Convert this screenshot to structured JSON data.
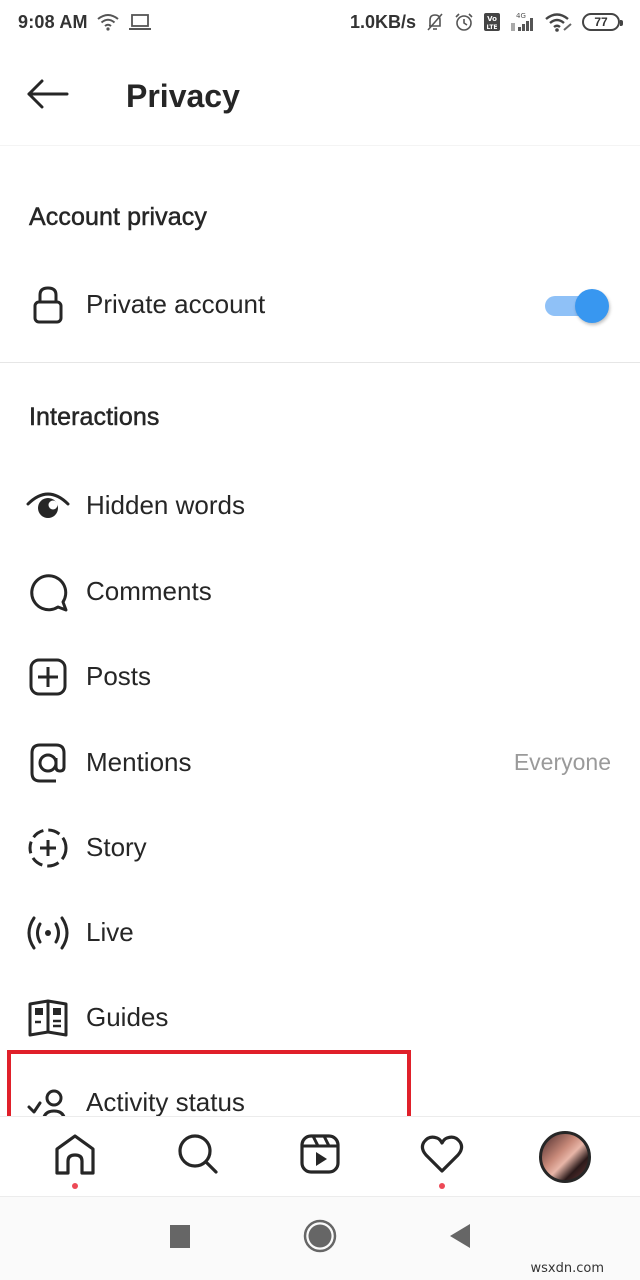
{
  "status_bar": {
    "time": "9:08 AM",
    "network_speed": "1.0KB/s",
    "battery_level": "77",
    "icons_left": [
      "wifi-icon",
      "laptop-icon"
    ],
    "icons_right": [
      "bell-muted-icon",
      "alarm-icon",
      "volte-icon",
      "signal-4g-icon",
      "wifi-icon",
      "battery-icon"
    ],
    "volte_label": "Vo\nLTE",
    "network_type": "4G"
  },
  "header": {
    "back_icon": "arrow-left-icon",
    "title": "Privacy"
  },
  "sections": [
    {
      "title": "Account privacy",
      "items": [
        {
          "label": "Private account",
          "icon": "lock-icon",
          "toggle": true,
          "toggle_on": true
        }
      ]
    },
    {
      "title": "Interactions",
      "items": [
        {
          "label": "Hidden words",
          "icon": "eye-icon"
        },
        {
          "label": "Comments",
          "icon": "comment-icon"
        },
        {
          "label": "Posts",
          "icon": "plus-square-icon"
        },
        {
          "label": "Mentions",
          "icon": "at-sign-icon",
          "value": "Everyone"
        },
        {
          "label": "Story",
          "icon": "story-add-icon"
        },
        {
          "label": "Live",
          "icon": "live-broadcast-icon"
        },
        {
          "label": "Guides",
          "icon": "guide-book-icon"
        },
        {
          "label": "Activity status",
          "icon": "activity-status-icon",
          "highlighted": true
        }
      ]
    }
  ],
  "colors": {
    "toggle_on": "#3897f0",
    "toggle_track": "#8fc1f7",
    "highlight_border": "#e0202a",
    "notification_dot": "#ed4956",
    "secondary_text": "#9a9a9a"
  },
  "bottom_nav": {
    "items": [
      {
        "name": "home",
        "icon": "home-icon",
        "dot": true
      },
      {
        "name": "search",
        "icon": "search-icon",
        "dot": false
      },
      {
        "name": "reels",
        "icon": "reels-icon",
        "dot": false
      },
      {
        "name": "activity",
        "icon": "heart-icon",
        "dot": true
      },
      {
        "name": "profile",
        "icon": "avatar",
        "dot": false
      }
    ]
  },
  "system_nav": {
    "items": [
      "recents-square-icon",
      "home-circle-icon",
      "back-triangle-icon"
    ]
  },
  "watermark": "wsxdn.com"
}
